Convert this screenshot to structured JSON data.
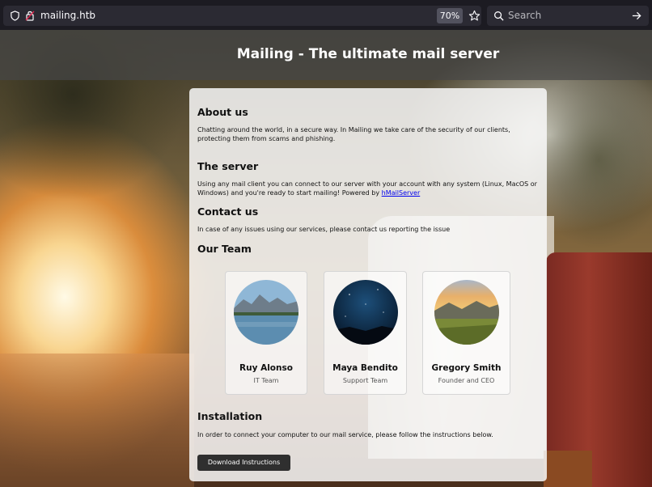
{
  "browser": {
    "url": "mailing.htb",
    "zoom": "70%",
    "search_placeholder": "Search"
  },
  "site": {
    "title": "Mailing - The ultimate mail server"
  },
  "sections": {
    "about": {
      "heading": "About us",
      "text": "Chatting around the world, in a secure way. In Mailing we take care of the security of our clients, protecting them from scams and phishing."
    },
    "server": {
      "heading": "The server",
      "text": "Using any mail client you can connect to our server with your account with any system (Linux, MacOS or Windows) and you're ready to start mailing! Powered by ",
      "link": "hMailServer"
    },
    "contact": {
      "heading": "Contact us",
      "text": "In case of any issues using our services, please contact us reporting the issue"
    },
    "team": {
      "heading": "Our Team",
      "members": [
        {
          "name": "Ruy Alonso",
          "role": "IT Team"
        },
        {
          "name": "Maya Bendito",
          "role": "Support Team"
        },
        {
          "name": "Gregory Smith",
          "role": "Founder and CEO"
        }
      ]
    },
    "installation": {
      "heading": "Installation",
      "text": "In order to connect your computer to our mail service, please follow the instructions below.",
      "button": "Download Instructions"
    }
  },
  "icons": {
    "shield": "shield-icon",
    "lock": "lock-icon",
    "star": "star-icon",
    "search": "search-icon",
    "arrow": "arrow-right-icon"
  }
}
